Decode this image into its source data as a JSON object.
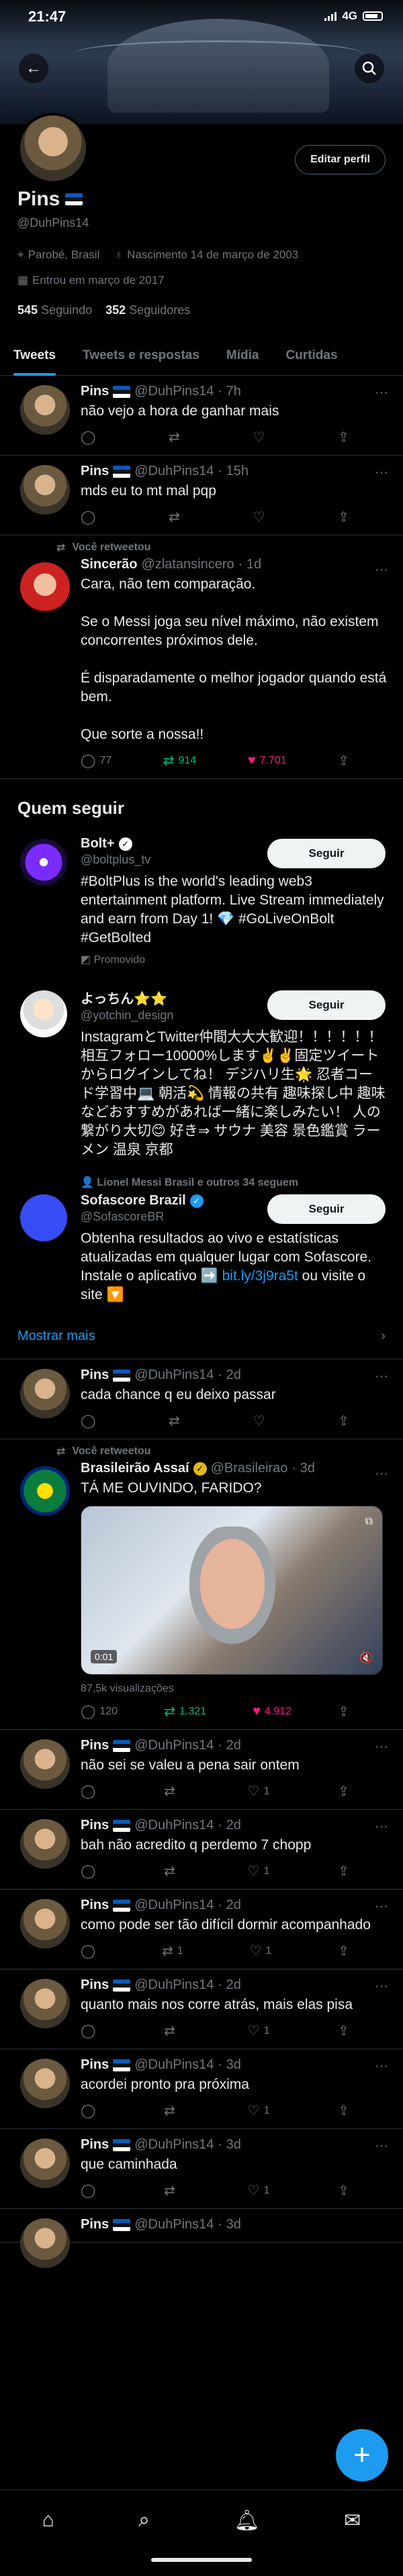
{
  "status_bar": {
    "time": "21:47",
    "network": "4G"
  },
  "profile": {
    "edit_button": "Editar perfil",
    "name": "Pins",
    "handle": "@DuhPins14",
    "location": "Parobé, Brasil",
    "birth": "Nascimento 14 de março de 2003",
    "joined": "Entrou em março de 2017",
    "following_count": "545",
    "following_label": "Seguindo",
    "followers_count": "352",
    "followers_label": "Seguidores"
  },
  "tabs": [
    {
      "label": "Tweets"
    },
    {
      "label": "Tweets e respostas"
    },
    {
      "label": "Mídia"
    },
    {
      "label": "Curtidas"
    }
  ],
  "icons": {
    "location": "location-icon",
    "birth": "balloon-icon",
    "calendar": "calendar-icon",
    "reply": "reply-icon",
    "retweet": "retweet-icon",
    "like": "heart-icon",
    "share": "share-icon"
  },
  "colors": {
    "accent": "#1d9bf0",
    "retweet": "#00ba7c",
    "like": "#f91880",
    "muted": "#71767b"
  },
  "tweets_top": [
    {
      "name": "Pins",
      "handle": "@DuhPins14",
      "time": "· 7h",
      "text": "não vejo a hora de ganhar mais"
    },
    {
      "name": "Pins",
      "handle": "@DuhPins14",
      "time": "· 15h",
      "text": "mds eu to mt mal pqp"
    }
  ],
  "retweet_1": {
    "label": "Você retweetou",
    "name": "Sincerão",
    "handle": "@zlatansincero",
    "time": "· 1d",
    "text": "Cara, não tem comparação.\n\nSe o Messi joga seu nível máximo, não existem concorrentes próximos dele.\n\nÉ disparadamente o melhor jogador quando está bem.\n\nQue sorte a nossa!!",
    "replies": "77",
    "retweets": "914",
    "likes": "7.701"
  },
  "who_to_follow": {
    "title": "Quem seguir",
    "follow_label": "Seguir",
    "items": [
      {
        "name": "Bolt+",
        "handle": "@boltplus_tv",
        "bio": "#BoltPlus is the world's leading web3 entertainment platform. Live Stream immediately and earn from Day 1! 💎 #GoLiveOnBolt #GetBolted",
        "promo": "Promovido"
      },
      {
        "name": "よっちん⭐️⭐️",
        "handle": "@yotchin_design",
        "bio": "InstagramとTwitter仲間大大大歓迎！！！！！！ 相互フォロー10000%します✌️✌️固定ツイートからログインしてね！ デジハリ生🌟 忍者コード学習中💻 朝活💫 情報の共有 趣味探し中 趣味などおすすめがあれば一緒に楽しみたい！ 人の繋がり大切😊 好き⇒ サウナ 美容 景色鑑賞 ラーメン 温泉 京都"
      },
      {
        "context": "Lionel Messi Brasil e outros 34 seguem",
        "name": "Sofascore Brazil",
        "handle": "@SofascoreBR",
        "bio": "Obtenha resultados ao vivo e estatísticas atualizadas em qualquer lugar com Sofascore. Instale o aplicativo ➡️ ",
        "bio_link": "bit.ly/3j9ra5t",
        "bio_tail": " ou visite o site 🔽"
      }
    ],
    "show_more": "Mostrar mais"
  },
  "tweet_3": {
    "name": "Pins",
    "handle": "@DuhPins14",
    "time": "· 2d",
    "text": "cada chance q eu deixo passar"
  },
  "retweet_2": {
    "label": "Você retweetou",
    "name": "Brasileirão Assaí",
    "handle": "@Brasileirao",
    "time": "· 3d",
    "text": "TÁ ME OUVINDO, FARIDO?",
    "video_time": "0:01",
    "views": "87,5k visualizações",
    "replies": "120",
    "retweets": "1.321",
    "likes": "4.912"
  },
  "tweets_bottom": [
    {
      "name": "Pins",
      "handle": "@DuhPins14",
      "time": "· 2d",
      "text": "não sei se valeu a pena sair ontem",
      "retweets": "",
      "likes": "1"
    },
    {
      "name": "Pins",
      "handle": "@DuhPins14",
      "time": "· 2d",
      "text": "bah não acredito q perdemo 7 chopp",
      "retweets": "",
      "likes": "1"
    },
    {
      "name": "Pins",
      "handle": "@DuhPins14",
      "time": "· 2d",
      "text": "como pode ser tão difícil dormir acompanhado",
      "retweets": "1",
      "likes": "1"
    },
    {
      "name": "Pins",
      "handle": "@DuhPins14",
      "time": "· 2d",
      "text": "quanto mais nos corre atrás, mais elas pisa",
      "retweets": "",
      "likes": "1"
    },
    {
      "name": "Pins",
      "handle": "@DuhPins14",
      "time": "· 3d",
      "text": "acordei pronto pra próxima",
      "retweets": "",
      "likes": "1"
    },
    {
      "name": "Pins",
      "handle": "@DuhPins14",
      "time": "· 3d",
      "text": "que caminhada",
      "retweets": "",
      "likes": "1"
    },
    {
      "name": "Pins",
      "handle": "@DuhPins14",
      "time": "· 3d",
      "text": "",
      "retweets": "",
      "likes": ""
    }
  ]
}
